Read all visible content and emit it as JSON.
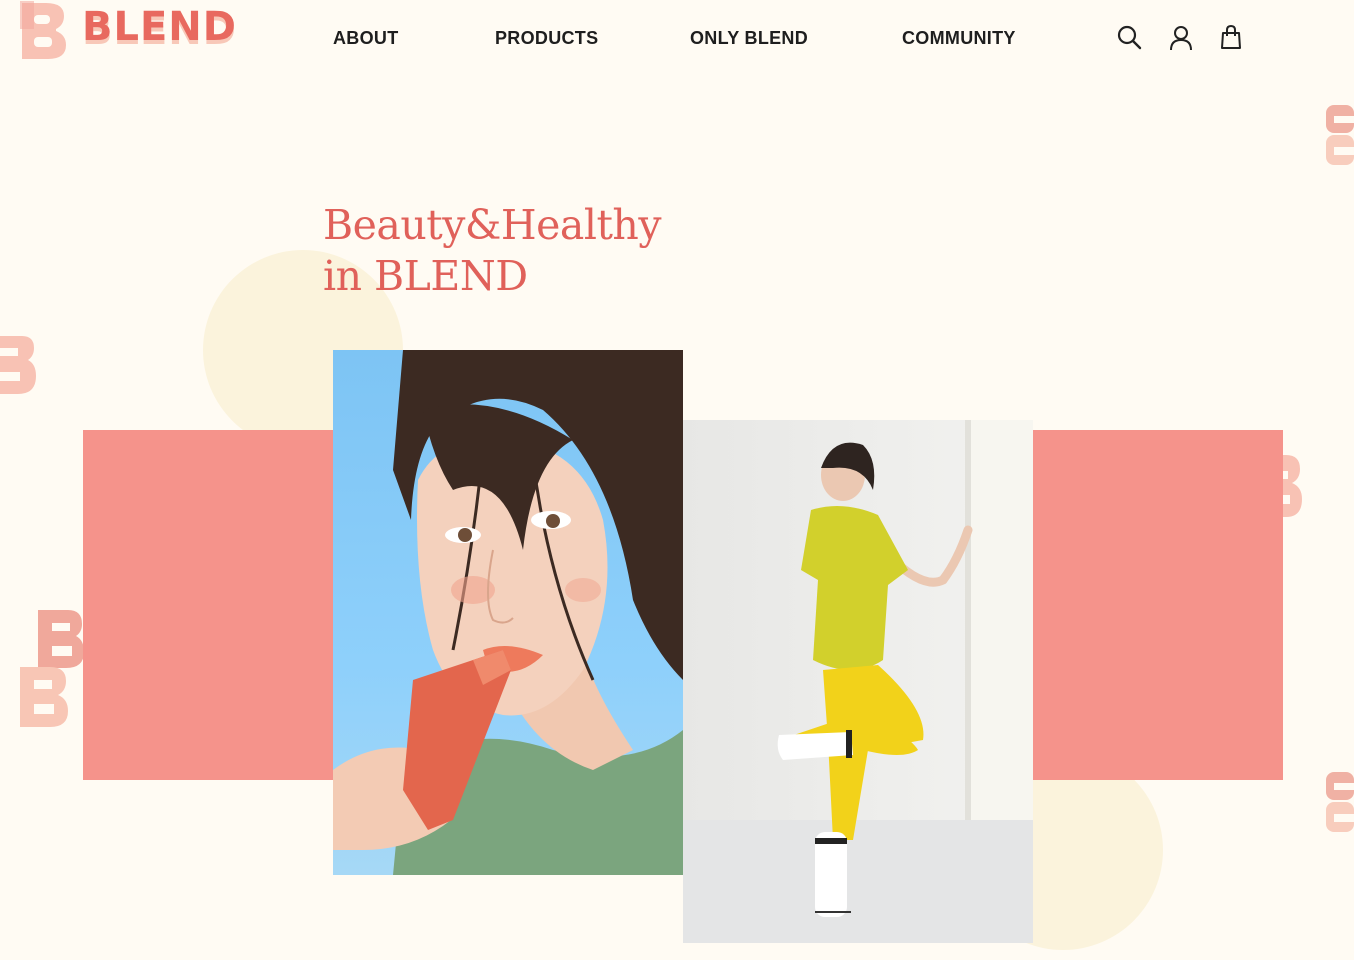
{
  "brand": {
    "name": "BLEND",
    "accent": "#E8695F",
    "accent_light": "#F8C8B8",
    "band_color": "#F5938B",
    "background": "#FFFBF3"
  },
  "nav": {
    "items": [
      {
        "label": "ABOUT"
      },
      {
        "label": "PRODUCTS"
      },
      {
        "label": "ONLY BLEND"
      },
      {
        "label": "COMMUNITY"
      }
    ],
    "icons": [
      "search-icon",
      "user-icon",
      "cart-icon"
    ]
  },
  "hero": {
    "headline_line1": "Beauty&Healthy",
    "headline_line2": "in BLEND",
    "images": [
      "beauty-photo",
      "healthy-photo"
    ]
  }
}
